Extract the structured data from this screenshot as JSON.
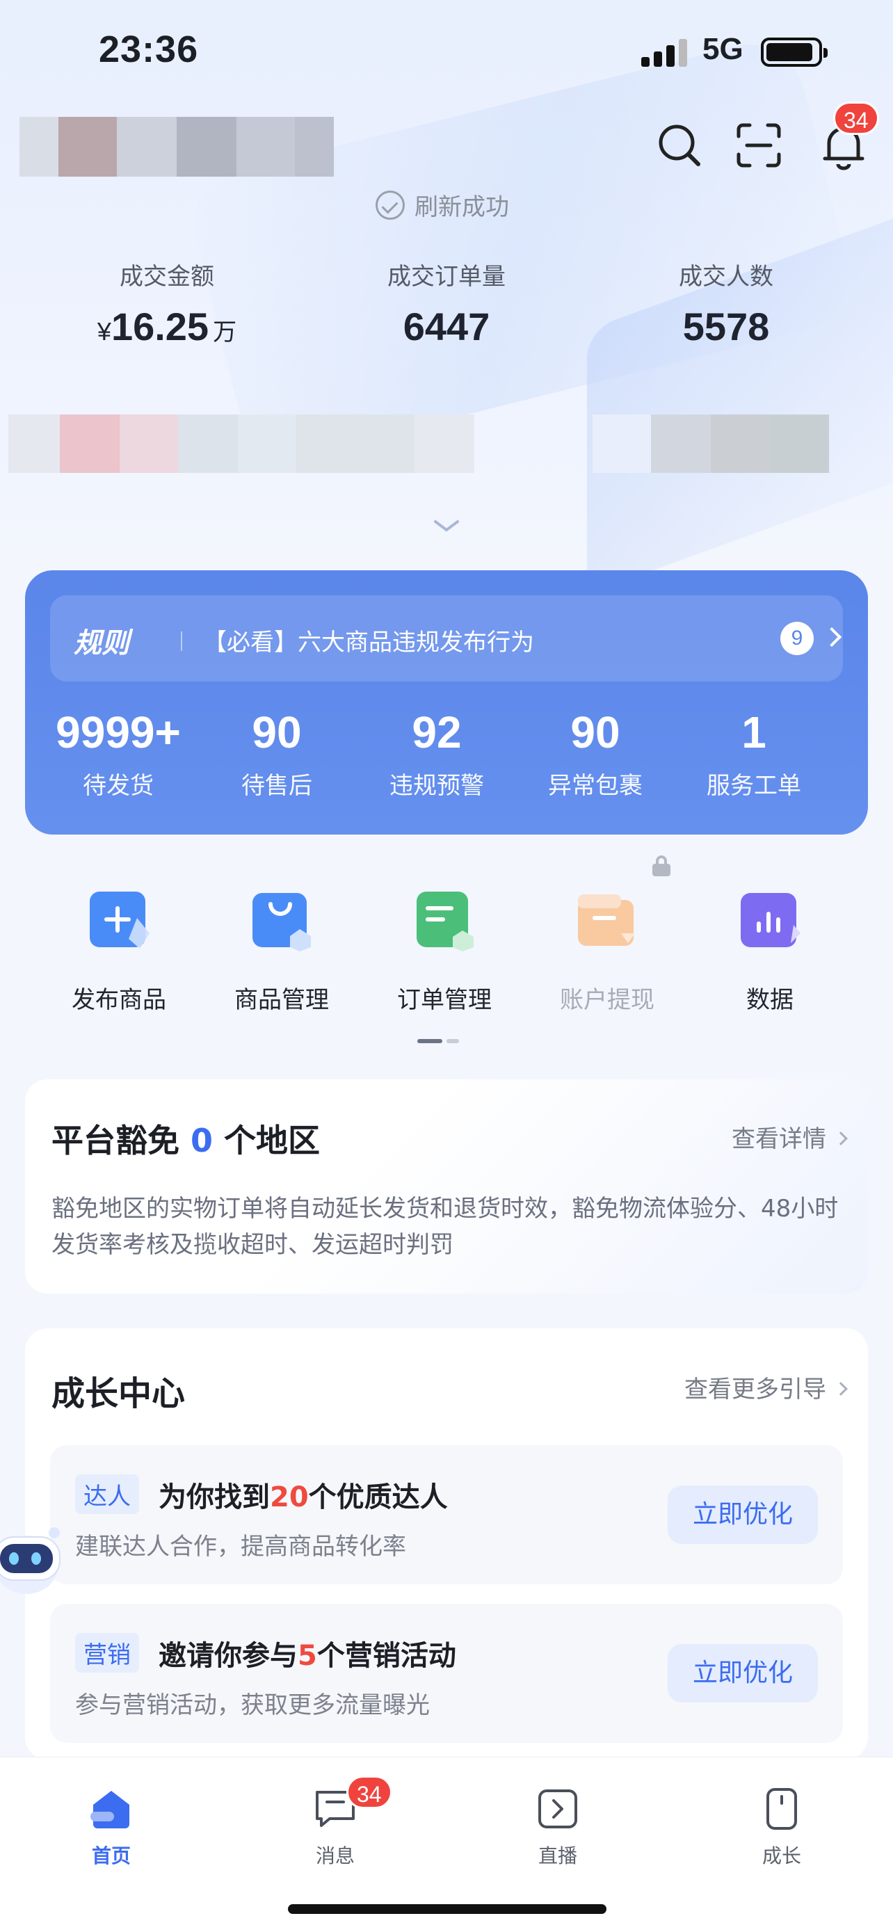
{
  "status_bar": {
    "time": "23:36",
    "network": "5G"
  },
  "header": {
    "notification_badge": "34"
  },
  "refresh_text": "刷新成功",
  "stats": [
    {
      "label": "成交金额",
      "currency": "¥",
      "value": "16.25",
      "unit": "万"
    },
    {
      "label": "成交订单量",
      "value": "6447"
    },
    {
      "label": "成交人数",
      "value": "5578"
    }
  ],
  "rules": {
    "tag": "规则",
    "text": "【必看】六大商品违规发布行为",
    "count": "9"
  },
  "metrics": [
    {
      "value": "9999+",
      "label": "待发货"
    },
    {
      "value": "90",
      "label": "待售后"
    },
    {
      "value": "92",
      "label": "违规预警"
    },
    {
      "value": "90",
      "label": "异常包裹"
    },
    {
      "value": "1",
      "label": "服务工单"
    }
  ],
  "actions": [
    {
      "label": "发布商品",
      "icon": "publish-product-icon",
      "color": "#4a8cf7"
    },
    {
      "label": "商品管理",
      "icon": "product-manage-icon",
      "color": "#4a8cf7"
    },
    {
      "label": "订单管理",
      "icon": "order-manage-icon",
      "color": "#4bbf7a"
    },
    {
      "label": "账户提现",
      "icon": "account-withdraw-icon",
      "color": "#f6b27a"
    },
    {
      "label": "数据",
      "icon": "data-icon",
      "color": "#7d6cf2"
    }
  ],
  "free_shipping": {
    "title_prefix": "平台豁免",
    "count": "0",
    "title_suffix": "个地区",
    "link": "查看详情",
    "description": "豁免地区的实物订单将自动延长发货和退货时效，豁免物流体验分、48小时发货率考核及揽收超时、发运超时判罚"
  },
  "growth": {
    "title": "成长中心",
    "link": "查看更多引导",
    "tasks": [
      {
        "tag": "达人",
        "title_pre": "为你找到",
        "highlight": "20",
        "title_post": "个优质达人",
        "subtitle": "建联达人合作，提高商品转化率",
        "button": "立即优化"
      },
      {
        "tag": "营销",
        "title_pre": "邀请你参与",
        "highlight": "5",
        "title_post": "个营销活动",
        "subtitle": "参与营销活动，获取更多流量曝光",
        "button": "立即优化"
      }
    ]
  },
  "tabbar": {
    "tabs": [
      {
        "label": "首页"
      },
      {
        "label": "消息",
        "badge": "34"
      },
      {
        "label": "直播"
      },
      {
        "label": "成长"
      }
    ]
  },
  "colors": {
    "accent": "#3c6cf0",
    "card_blue": "#5b86ea",
    "badge_red": "#f0433d",
    "highlight_red": "#ef4a3f"
  }
}
